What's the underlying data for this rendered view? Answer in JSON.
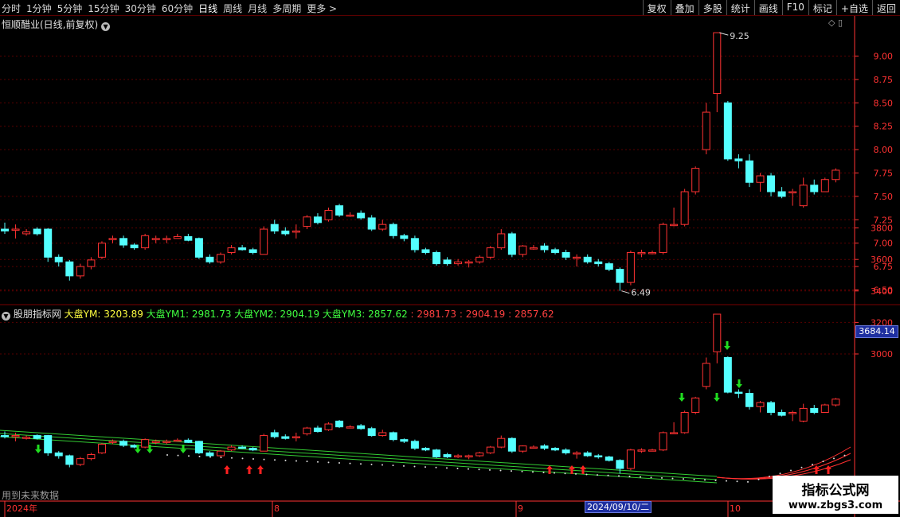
{
  "toolbar": {
    "periods": [
      "分时",
      "1分钟",
      "5分钟",
      "15分钟",
      "30分钟",
      "60分钟",
      "日线",
      "周线",
      "月线",
      "多周期",
      "更多 >"
    ],
    "active_period": "日线",
    "actions": [
      "复权",
      "叠加",
      "多股",
      "统计",
      "画线",
      "F10",
      "标记",
      "+自选",
      "返回"
    ]
  },
  "stock": {
    "title": "恒顺醋业(日线,前复权)",
    "high_label": "9.25",
    "low_label": "6.49"
  },
  "indicator": {
    "name": "股朋指标网",
    "items": [
      {
        "text": "大盘YM: 3203.89",
        "color": "#ffff40"
      },
      {
        "text": "大盘YM1: 2981.73",
        "color": "#40ff40"
      },
      {
        "text": "大盘YM2: 2904.19",
        "color": "#40ff40"
      },
      {
        "text": "大盘YM3: 2857.62",
        "color": "#40ff40"
      },
      {
        "text": ": 2981.73",
        "color": "#ff4040"
      },
      {
        "text": ": 2904.19",
        "color": "#ff4040"
      },
      {
        "text": ": 2857.62",
        "color": "#ff4040"
      }
    ],
    "current_badge": "3684.14",
    "future_note": "用到未来数据"
  },
  "price_axis": [
    "9.00",
    "8.75",
    "8.50",
    "8.25",
    "8.00",
    "7.75",
    "7.50",
    "7.25",
    "7.00",
    "6.75",
    "6.50"
  ],
  "ind_axis": [
    "3800",
    "3600",
    "3400",
    "3200",
    "3000"
  ],
  "time_axis": {
    "labels": [
      "2024年",
      "8",
      "9",
      "10"
    ],
    "cursor_date": "2024/09/10/二"
  },
  "colors": {
    "up": "#ff3232",
    "down": "#54ffff",
    "grid": "#5a0000",
    "axis": "#ff3232",
    "ma": "#33cc33"
  },
  "watermark": {
    "title": "指标公式网",
    "url": "www.zbgs3.com"
  },
  "chart_data": {
    "type": "candlestick",
    "price_range": [
      6.4,
      9.25
    ],
    "candles": [
      [
        7.15,
        7.13,
        7.22,
        7.1
      ],
      [
        7.15,
        7.15,
        7.2,
        7.05
      ],
      [
        7.1,
        7.12,
        7.15,
        7.08
      ],
      [
        7.15,
        7.1,
        7.17,
        7.08
      ],
      [
        7.15,
        6.85,
        7.16,
        6.8
      ],
      [
        6.85,
        6.8,
        6.88,
        6.75
      ],
      [
        6.8,
        6.65,
        6.82,
        6.6
      ],
      [
        6.65,
        6.75,
        6.78,
        6.62
      ],
      [
        6.75,
        6.82,
        6.85,
        6.72
      ],
      [
        6.85,
        7.0,
        7.02,
        6.83
      ],
      [
        7.05,
        7.05,
        7.08,
        7.0
      ],
      [
        7.05,
        6.98,
        7.08,
        6.95
      ],
      [
        6.98,
        6.95,
        7.0,
        6.93
      ],
      [
        6.95,
        7.08,
        7.1,
        6.93
      ],
      [
        7.05,
        7.05,
        7.08,
        7.0
      ],
      [
        7.05,
        7.05,
        7.08,
        7.0
      ],
      [
        7.05,
        7.07,
        7.1,
        7.05
      ],
      [
        7.07,
        7.03,
        7.1,
        7.02
      ],
      [
        7.05,
        6.85,
        7.06,
        6.83
      ],
      [
        6.85,
        6.8,
        6.88,
        6.78
      ],
      [
        6.8,
        6.88,
        6.9,
        6.78
      ],
      [
        6.9,
        6.95,
        6.98,
        6.88
      ],
      [
        6.95,
        6.93,
        6.98,
        6.92
      ],
      [
        6.93,
        6.9,
        6.95,
        6.88
      ],
      [
        6.88,
        7.15,
        7.18,
        6.88
      ],
      [
        7.2,
        7.13,
        7.25,
        7.1
      ],
      [
        7.13,
        7.1,
        7.17,
        7.08
      ],
      [
        7.13,
        7.13,
        7.2,
        7.05
      ],
      [
        7.18,
        7.28,
        7.3,
        7.15
      ],
      [
        7.28,
        7.22,
        7.32,
        7.2
      ],
      [
        7.25,
        7.35,
        7.38,
        7.23
      ],
      [
        7.4,
        7.3,
        7.42,
        7.28
      ],
      [
        7.3,
        7.3,
        7.33,
        7.28
      ],
      [
        7.32,
        7.27,
        7.35,
        7.25
      ],
      [
        7.27,
        7.15,
        7.3,
        7.13
      ],
      [
        7.15,
        7.2,
        7.25,
        7.13
      ],
      [
        7.2,
        7.08,
        7.22,
        7.05
      ],
      [
        7.08,
        7.05,
        7.1,
        7.02
      ],
      [
        7.05,
        6.93,
        7.08,
        6.9
      ],
      [
        6.93,
        6.9,
        6.95,
        6.88
      ],
      [
        6.9,
        6.78,
        6.92,
        6.76
      ],
      [
        6.82,
        6.78,
        6.85,
        6.76
      ],
      [
        6.78,
        6.8,
        6.83,
        6.76
      ],
      [
        6.8,
        6.8,
        6.82,
        6.74
      ],
      [
        6.8,
        6.85,
        6.87,
        6.78
      ],
      [
        6.85,
        6.95,
        6.97,
        6.83
      ],
      [
        6.95,
        7.1,
        7.15,
        6.93
      ],
      [
        7.1,
        6.88,
        7.12,
        6.85
      ],
      [
        6.88,
        6.97,
        6.98,
        6.85
      ],
      [
        6.95,
        6.95,
        6.98,
        6.93
      ],
      [
        6.97,
        6.93,
        7.0,
        6.9
      ],
      [
        6.93,
        6.9,
        6.95,
        6.88
      ],
      [
        6.9,
        6.85,
        6.93,
        6.82
      ],
      [
        6.85,
        6.85,
        6.88,
        6.75
      ],
      [
        6.85,
        6.8,
        6.88,
        6.78
      ],
      [
        6.8,
        6.78,
        6.83,
        6.75
      ],
      [
        6.78,
        6.72,
        6.8,
        6.7
      ],
      [
        6.72,
        6.58,
        6.74,
        6.49
      ],
      [
        6.58,
        6.9,
        6.92,
        6.55
      ],
      [
        6.9,
        6.9,
        6.93,
        6.85
      ],
      [
        6.9,
        6.9,
        6.92,
        6.88
      ],
      [
        6.9,
        7.2,
        7.22,
        6.88
      ],
      [
        7.2,
        7.2,
        7.38,
        7.18
      ],
      [
        7.2,
        7.55,
        7.58,
        7.18
      ],
      [
        7.55,
        7.8,
        7.82,
        7.52
      ],
      [
        8.0,
        8.4,
        8.5,
        7.95
      ],
      [
        8.6,
        9.25,
        9.25,
        8.4
      ],
      [
        8.5,
        7.9,
        8.52,
        7.88
      ],
      [
        7.9,
        7.88,
        7.95,
        7.8
      ],
      [
        7.88,
        7.65,
        7.95,
        7.6
      ],
      [
        7.65,
        7.72,
        7.75,
        7.55
      ],
      [
        7.72,
        7.55,
        7.75,
        7.5
      ],
      [
        7.55,
        7.5,
        7.6,
        7.48
      ],
      [
        7.55,
        7.55,
        7.58,
        7.4
      ],
      [
        7.4,
        7.62,
        7.7,
        7.38
      ],
      [
        7.62,
        7.55,
        7.68,
        7.52
      ],
      [
        7.55,
        7.68,
        7.7,
        7.55
      ],
      [
        7.68,
        7.78,
        7.8,
        7.65
      ]
    ]
  }
}
